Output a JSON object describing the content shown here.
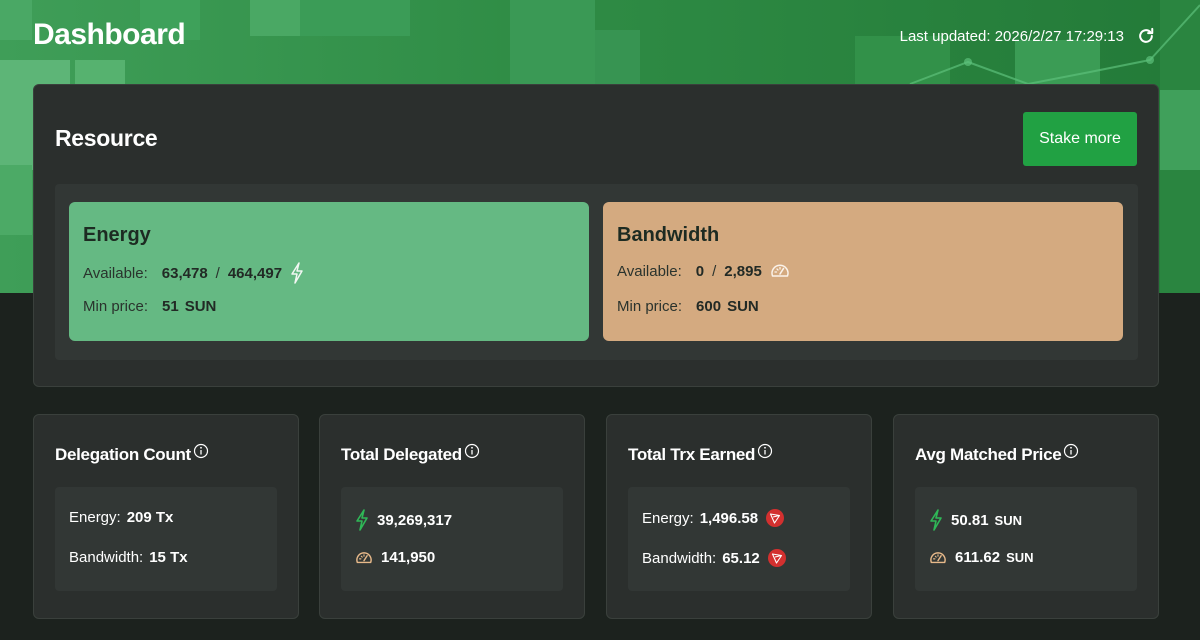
{
  "header": {
    "title": "Dashboard",
    "last_updated": "Last updated: 2026/2/27 17:29:13"
  },
  "resource": {
    "title": "Resource",
    "stake_label": "Stake more",
    "energy": {
      "name": "Energy",
      "available_label": "Available:",
      "available_value": "63,478",
      "separator": "/",
      "total_value": "464,497",
      "min_price_label": "Min price:",
      "min_price_value": "51",
      "min_price_unit": "SUN"
    },
    "bandwidth": {
      "name": "Bandwidth",
      "available_label": "Available:",
      "available_value": "0",
      "separator": "/",
      "total_value": "2,895",
      "min_price_label": "Min price:",
      "min_price_value": "600",
      "min_price_unit": "SUN"
    }
  },
  "stats": {
    "delegation_count": {
      "title": "Delegation Count",
      "energy_label": "Energy:",
      "energy_value": "209 Tx",
      "bandwidth_label": "Bandwidth:",
      "bandwidth_value": "15 Tx"
    },
    "total_delegated": {
      "title": "Total Delegated",
      "energy_value": "39,269,317",
      "bandwidth_value": "141,950"
    },
    "total_trx_earned": {
      "title": "Total Trx Earned",
      "energy_label": "Energy:",
      "energy_value": "1,496.58",
      "bandwidth_label": "Bandwidth:",
      "bandwidth_value": "65.12"
    },
    "avg_matched_price": {
      "title": "Avg Matched Price",
      "energy_value": "50.81",
      "energy_unit": "SUN",
      "bandwidth_value": "611.62",
      "bandwidth_unit": "SUN"
    }
  },
  "icons": {
    "energy": "lightning-icon",
    "bandwidth": "speedometer-icon",
    "trx": "tron-icon",
    "info": "info-icon",
    "refresh": "refresh-icon"
  },
  "colors": {
    "accent_green": "#21a143",
    "energy_box": "#65b983",
    "bandwidth_box": "#d4aa80",
    "trx_red": "#d3302f",
    "banner_green": "#2f8c45"
  }
}
